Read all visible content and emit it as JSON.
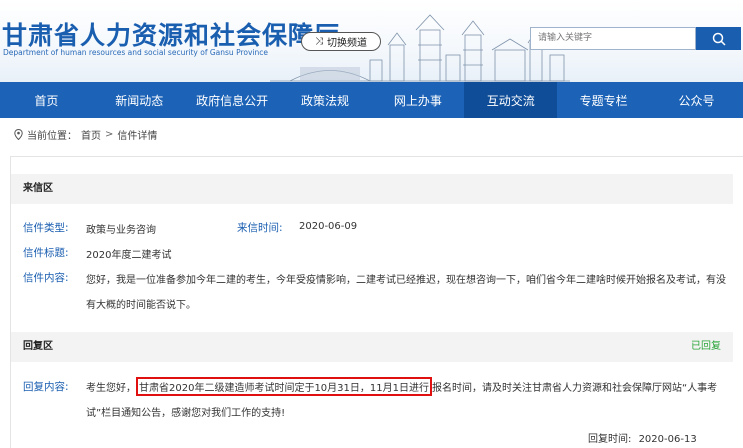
{
  "header": {
    "title": "甘肃省人力资源和社会保障厅",
    "subtitle": "Department of human resources and social security of Gansu Province",
    "switch_label": "切换频道",
    "search_placeholder": "请输入关键字"
  },
  "nav": {
    "items": [
      "首页",
      "新闻动态",
      "政府信息公开",
      "政策法规",
      "网上办事",
      "互动交流",
      "专题专栏",
      "公众号"
    ],
    "active_index": 5
  },
  "breadcrumb": {
    "prefix": "当前位置：",
    "home": "首页",
    "separator": ">",
    "current": "信件详情"
  },
  "letter": {
    "section_title": "来信区",
    "type_label": "信件类型:",
    "type_value": "政策与业务咨询",
    "time_label": "来信时间:",
    "time_value": "2020-06-09",
    "title_label": "信件标题:",
    "title_value": "2020年度二建考试",
    "content_label": "信件内容:",
    "content_line1": "您好，我是一位准备参加今年二建的考生，今年受疫情影响，二建考试已经推迟，现在想咨询一下，咱们省今年二建啥时候开始报名及考试，有没",
    "content_line2": "有大概的时间能否说下。"
  },
  "reply": {
    "section_title": "回复区",
    "status": "已回复",
    "content_label": "回复内容:",
    "content_before": "考生您好，",
    "content_highlight": "甘肃省2020年二级建造师考试时间定于10月31日，11月1日进行",
    "content_after": "报名时间，请及时关注甘肃省人力资源和社会保障厅网站“人事考",
    "content_line2": "试”栏目通知公告，感谢您对我们工作的支持!",
    "time_label": "回复时间:",
    "time_value": "2020-06-13"
  },
  "colors": {
    "brand_blue": "#1c63b7",
    "active_nav": "#0f4d99",
    "label_blue": "#1a5eb0",
    "reply_green": "#2aa53a",
    "highlight_red": "#e01010"
  }
}
